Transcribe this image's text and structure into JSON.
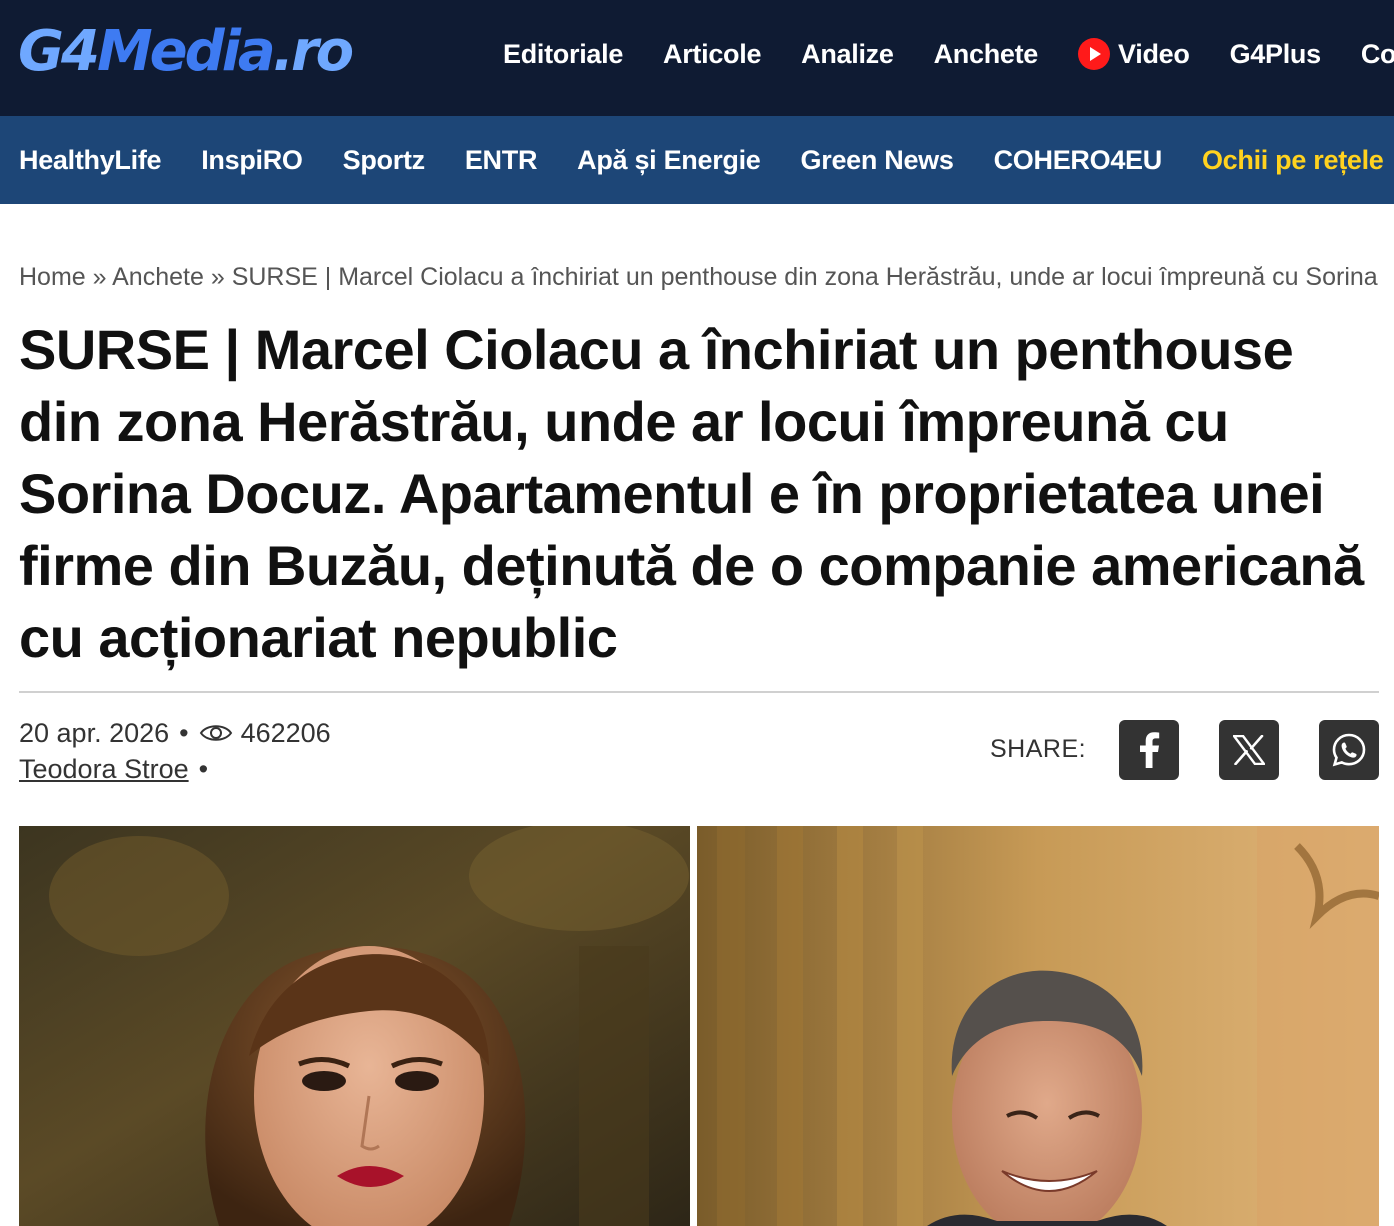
{
  "site": {
    "logo": {
      "part1": "G4",
      "part2": "Media",
      "part3": ".ro"
    }
  },
  "topnav": {
    "items": [
      {
        "label": "Editoriale"
      },
      {
        "label": "Articole"
      },
      {
        "label": "Analize"
      },
      {
        "label": "Anchete"
      },
      {
        "label": "Video",
        "icon": "play-icon"
      },
      {
        "label": "G4Plus"
      },
      {
        "label": "Co"
      }
    ]
  },
  "subnav": {
    "items": [
      {
        "label": "HealthyLife"
      },
      {
        "label": "InspiRO"
      },
      {
        "label": "Sportz"
      },
      {
        "label": "ENTR"
      },
      {
        "label": "Apă și Energie"
      },
      {
        "label": "Green News"
      },
      {
        "label": "COHERO4EU"
      },
      {
        "label": "Ochii pe rețele"
      }
    ],
    "highlight_color": "#ffd21f"
  },
  "breadcrumb": {
    "home": "Home",
    "sep": "»",
    "section": "Anchete",
    "current": "SURSE | Marcel Ciolacu a închiriat un penthouse din zona Herăstrău, unde ar locui împreună cu Sorina"
  },
  "article": {
    "title": "SURSE | Marcel Ciolacu a închiriat un penthouse din zona Herăstrău, unde ar locui împreună cu Sorina Docuz. Apartamentul e în proprietatea unei firme din Buzău, deținută de o companie americană cu acționariat nepublic",
    "date": "20 apr. 2026",
    "bullet": "•",
    "views": "462206",
    "author": "Teodora Stroe"
  },
  "share": {
    "label": "SHARE:",
    "buttons": [
      {
        "icon": "facebook-icon"
      },
      {
        "icon": "x-icon"
      },
      {
        "icon": "whatsapp-icon"
      }
    ]
  },
  "colors": {
    "topbar": "#0f1b33",
    "subbar": "#1d4677",
    "logo_blue": "#3e7bf2",
    "video_red": "#ff1a1a"
  }
}
